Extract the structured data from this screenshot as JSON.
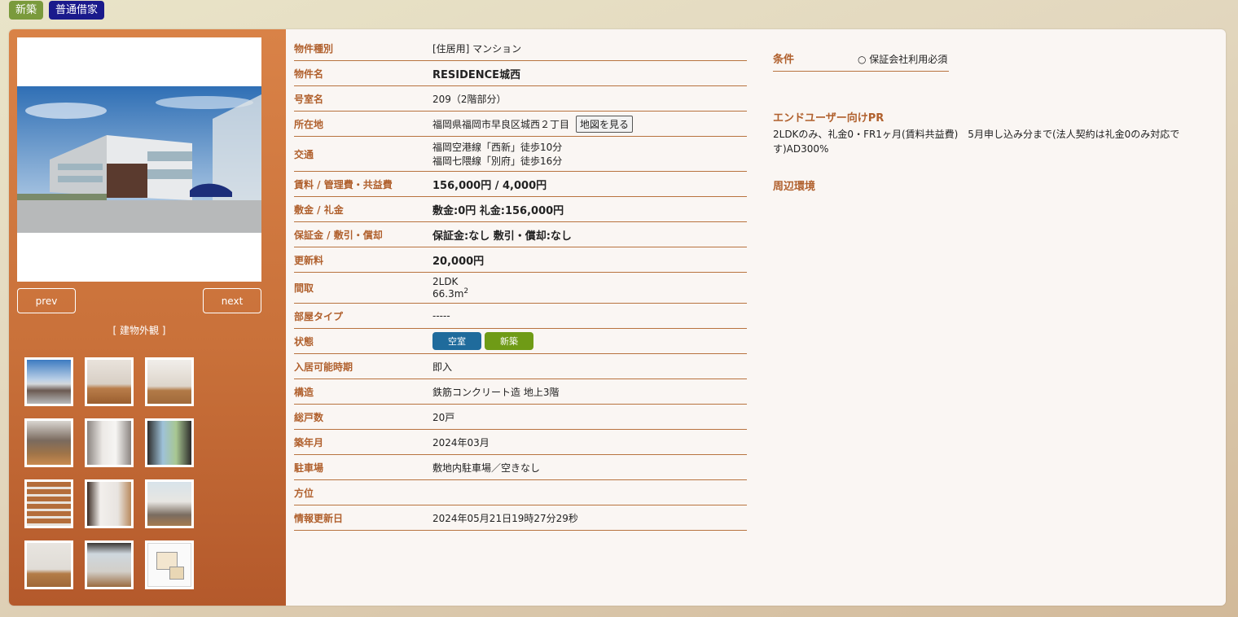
{
  "tags": {
    "new": "新築",
    "lease": "普通借家"
  },
  "gallery": {
    "prev": "prev",
    "next": "next",
    "caption": "[ 建物外観 ]",
    "thumbnails": [
      "exterior",
      "room",
      "living",
      "kitchen",
      "toilet",
      "balcony",
      "stairs",
      "closet",
      "washroom",
      "bedroom",
      "window-room",
      "floorplan"
    ]
  },
  "details": {
    "type": {
      "label": "物件種別",
      "value": "[住居用] マンション"
    },
    "name": {
      "label": "物件名",
      "value": "RESIDENCE城西"
    },
    "room": {
      "label": "号室名",
      "value": "209（2階部分）"
    },
    "address": {
      "label": "所在地",
      "value": "福岡県福岡市早良区城西２丁目",
      "map_button": "地図を見る"
    },
    "transit": {
      "label": "交通",
      "line1": "福岡空港線「西新」徒歩10分",
      "line2": "福岡七隈線「別府」徒歩16分"
    },
    "rent": {
      "label": "賃料 / 管理費・共益費",
      "value": "156,000円 / 4,000円"
    },
    "deposit": {
      "label": "敷金 / 礼金",
      "value": "敷金:0円 礼金:156,000円"
    },
    "guarantee": {
      "label": "保証金 / 敷引・償却",
      "value": "保証金:なし 敷引・償却:なし"
    },
    "renewal": {
      "label": "更新料",
      "value": "20,000円"
    },
    "layout": {
      "label": "間取",
      "plan": "2LDK",
      "area": "66.3m",
      "unit_sup": "2"
    },
    "room_type": {
      "label": "部屋タイプ",
      "value": "-----"
    },
    "status": {
      "label": "状態",
      "vacant": "空室",
      "new": "新築"
    },
    "move_in": {
      "label": "入居可能時期",
      "value": "即入"
    },
    "structure": {
      "label": "構造",
      "value": "鉄筋コンクリート造 地上3階"
    },
    "units": {
      "label": "総戸数",
      "value": "20戸"
    },
    "built": {
      "label": "築年月",
      "value": "2024年03月"
    },
    "parking": {
      "label": "駐車場",
      "value": "敷地内駐車場／空きなし"
    },
    "direction": {
      "label": "方位",
      "value": ""
    },
    "updated": {
      "label": "情報更新日",
      "value": "2024年05月21日19時27分29秒"
    }
  },
  "conditions": {
    "label": "条件",
    "value": "○ 保証会社利用必須"
  },
  "pr": {
    "title": "エンドユーザー向けPR",
    "text": "2LDKのみ、礼金0・FR1ヶ月(賃料共益費)　5月申し込み分まで(法人契約は礼金0のみ対応です)AD300%"
  },
  "environment": {
    "title": "周辺環境"
  },
  "colors": {
    "accent": "#b0602d",
    "sidebar": "#c9713a",
    "vacant": "#1f6b9c",
    "new": "#6f9b16",
    "lease": "#1a1a8c"
  }
}
